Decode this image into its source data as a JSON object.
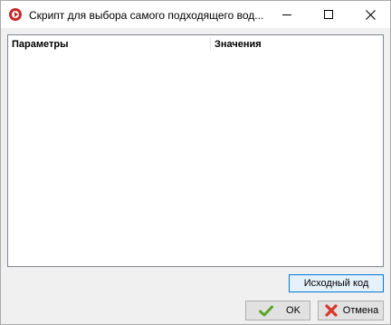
{
  "window": {
    "title": "Скрипт для выбора самого подходящего вод...",
    "app_icon": "media-player-icon",
    "controls": [
      "minimize-icon",
      "maximize-icon",
      "close-icon"
    ]
  },
  "table": {
    "columns": [
      "Параметры",
      "Значения"
    ],
    "rows": []
  },
  "buttons": {
    "source_code": "Исходный код",
    "ok": "OK",
    "cancel": "Отмена"
  },
  "icons": {
    "ok": "green-check-icon",
    "cancel": "red-x-icon"
  },
  "colors": {
    "app_icon": "#c62828",
    "ok_icon": "#5aa52a",
    "cancel_icon": "#d9362b",
    "focus_border": "#0078d7"
  }
}
